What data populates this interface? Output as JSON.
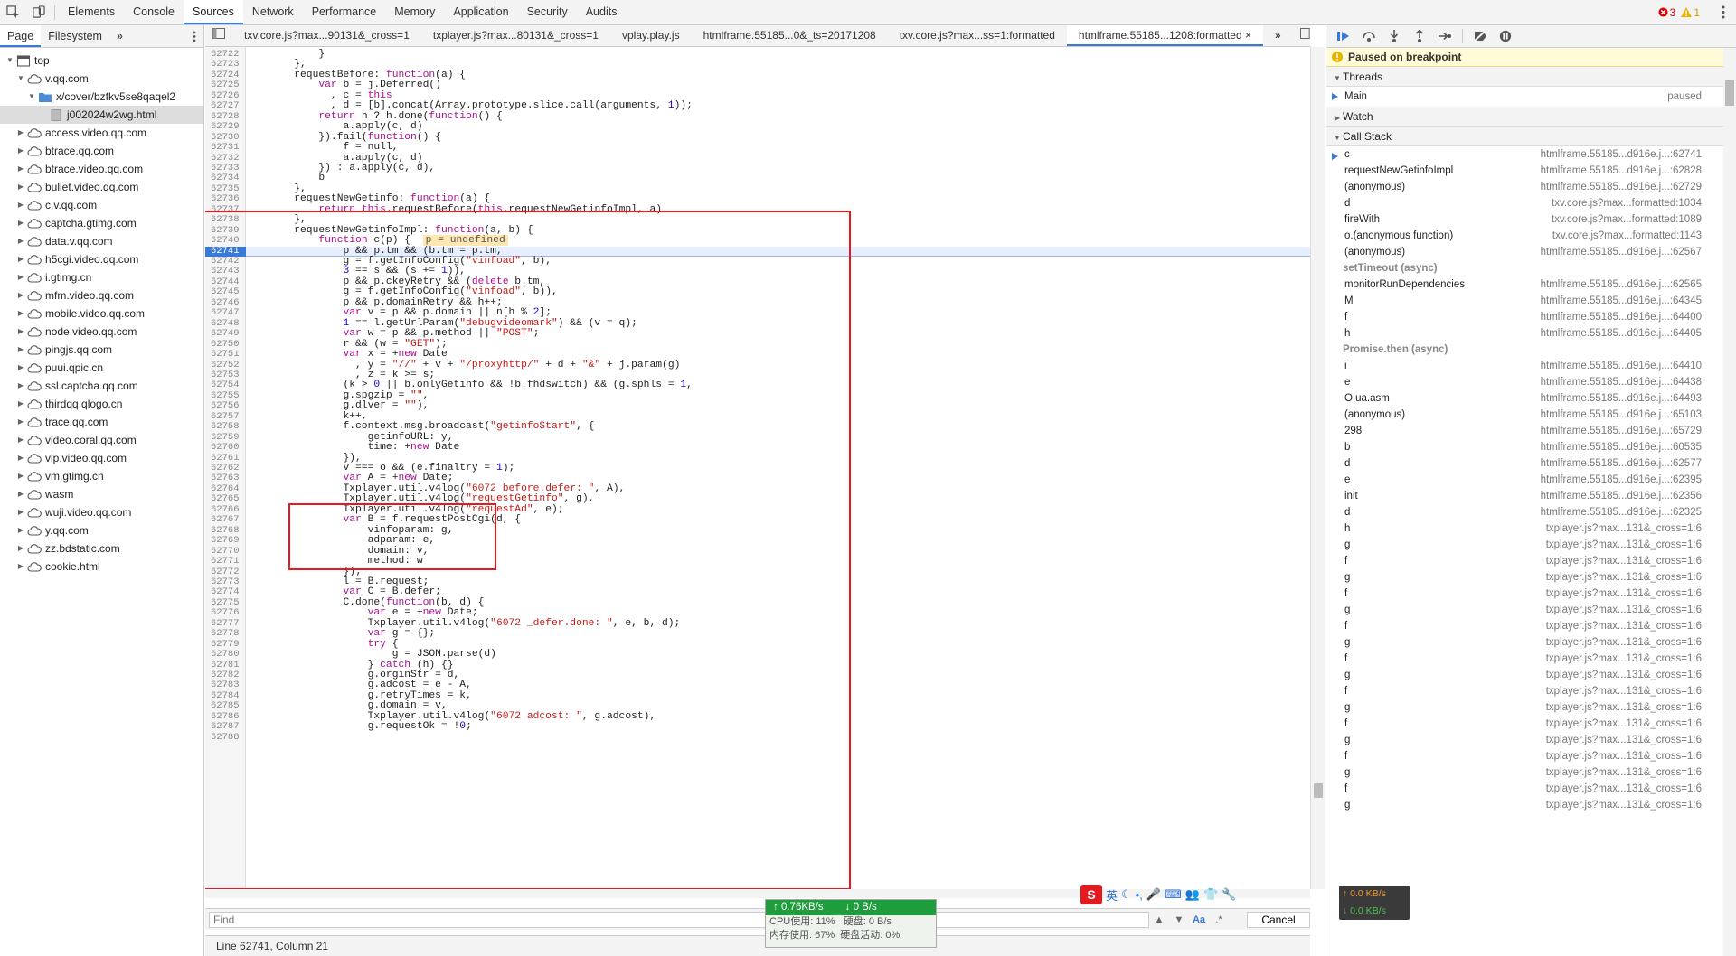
{
  "main_tabs": [
    "Elements",
    "Console",
    "Sources",
    "Network",
    "Performance",
    "Memory",
    "Application",
    "Security",
    "Audits"
  ],
  "active_main_tab": "Sources",
  "error_count": "3",
  "warning_count": "1",
  "sidebar": {
    "tabs": [
      "Page",
      "Filesystem"
    ],
    "tree": [
      {
        "label": "top",
        "depth": 0,
        "open": true,
        "kind": "frame"
      },
      {
        "label": "v.qq.com",
        "depth": 1,
        "open": true,
        "kind": "cloud"
      },
      {
        "label": "x/cover/bzfkv5se8qaqel2",
        "depth": 2,
        "open": true,
        "kind": "folder"
      },
      {
        "label": "j002024w2wg.html",
        "depth": 3,
        "open": false,
        "kind": "file",
        "selected": true
      },
      {
        "label": "access.video.qq.com",
        "depth": 1,
        "kind": "cloud"
      },
      {
        "label": "btrace.qq.com",
        "depth": 1,
        "kind": "cloud"
      },
      {
        "label": "btrace.video.qq.com",
        "depth": 1,
        "kind": "cloud"
      },
      {
        "label": "bullet.video.qq.com",
        "depth": 1,
        "kind": "cloud"
      },
      {
        "label": "c.v.qq.com",
        "depth": 1,
        "kind": "cloud"
      },
      {
        "label": "captcha.gtimg.com",
        "depth": 1,
        "kind": "cloud"
      },
      {
        "label": "data.v.qq.com",
        "depth": 1,
        "kind": "cloud"
      },
      {
        "label": "h5cgi.video.qq.com",
        "depth": 1,
        "kind": "cloud"
      },
      {
        "label": "i.gtimg.cn",
        "depth": 1,
        "kind": "cloud"
      },
      {
        "label": "mfm.video.qq.com",
        "depth": 1,
        "kind": "cloud"
      },
      {
        "label": "mobile.video.qq.com",
        "depth": 1,
        "kind": "cloud"
      },
      {
        "label": "node.video.qq.com",
        "depth": 1,
        "kind": "cloud"
      },
      {
        "label": "pingjs.qq.com",
        "depth": 1,
        "kind": "cloud"
      },
      {
        "label": "puui.qpic.cn",
        "depth": 1,
        "kind": "cloud"
      },
      {
        "label": "ssl.captcha.qq.com",
        "depth": 1,
        "kind": "cloud"
      },
      {
        "label": "thirdqq.qlogo.cn",
        "depth": 1,
        "kind": "cloud"
      },
      {
        "label": "trace.qq.com",
        "depth": 1,
        "kind": "cloud"
      },
      {
        "label": "video.coral.qq.com",
        "depth": 1,
        "kind": "cloud"
      },
      {
        "label": "vip.video.qq.com",
        "depth": 1,
        "kind": "cloud"
      },
      {
        "label": "vm.gtimg.cn",
        "depth": 1,
        "kind": "cloud"
      },
      {
        "label": "wasm",
        "depth": 1,
        "kind": "cloud"
      },
      {
        "label": "wuji.video.qq.com",
        "depth": 1,
        "kind": "cloud"
      },
      {
        "label": "y.qq.com",
        "depth": 1,
        "kind": "cloud"
      },
      {
        "label": "zz.bdstatic.com",
        "depth": 1,
        "kind": "cloud"
      },
      {
        "label": "cookie.html",
        "depth": 1,
        "kind": "cloud"
      }
    ]
  },
  "editor_tabs": [
    "txv.core.js?max...90131&_cross=1",
    "txplayer.js?max...80131&_cross=1",
    "vplay.play.js",
    "htmlframe.55185...0&_ts=20171208",
    "txv.core.js?max...ss=1:formatted",
    "htmlframe.55185...1208:formatted"
  ],
  "active_editor_tab": 5,
  "breakpoint_line": "62741",
  "code_lines": [
    {
      "n": "62722",
      "t": "            }"
    },
    {
      "n": "62723",
      "t": "        },"
    },
    {
      "n": "62724",
      "t": "        requestBefore: function(a) {"
    },
    {
      "n": "62725",
      "t": "            var b = j.Deferred()"
    },
    {
      "n": "62726",
      "t": "              , c = this"
    },
    {
      "n": "62727",
      "t": "              , d = [b].concat(Array.prototype.slice.call(arguments, 1));"
    },
    {
      "n": "62728",
      "t": "            return h ? h.done(function() {"
    },
    {
      "n": "62729",
      "t": "                a.apply(c, d)"
    },
    {
      "n": "62730",
      "t": "            }).fail(function() {"
    },
    {
      "n": "62731",
      "t": "                f = null,"
    },
    {
      "n": "62732",
      "t": "                a.apply(c, d)"
    },
    {
      "n": "62733",
      "t": "            }) : a.apply(c, d),"
    },
    {
      "n": "62734",
      "t": "            b"
    },
    {
      "n": "62735",
      "t": "        },"
    },
    {
      "n": "62736",
      "t": "        requestNewGetinfo: function(a) {"
    },
    {
      "n": "62737",
      "t": "            return this.requestBefore(this.requestNewGetinfoImpl, a)"
    },
    {
      "n": "62738",
      "t": "        },"
    },
    {
      "n": "62739",
      "t": "        requestNewGetinfoImpl: function(a, b) {"
    },
    {
      "n": "62740",
      "t": "            function c(p) {  ",
      "inline": "p = undefined"
    },
    {
      "n": "62741",
      "t": "                p && p.tm && (b.tm = p.tm,"
    },
    {
      "n": "62742",
      "t": "                g = f.getInfoConfig(\"vinfoad\", b),"
    },
    {
      "n": "62743",
      "t": "                3 == s && (s += 1)),"
    },
    {
      "n": "62744",
      "t": "                p && p.ckeyRetry && (delete b.tm,"
    },
    {
      "n": "62745",
      "t": "                g = f.getInfoConfig(\"vinfoad\", b)),"
    },
    {
      "n": "62746",
      "t": "                p && p.domainRetry && h++;"
    },
    {
      "n": "62747",
      "t": "                var v = p && p.domain || n[h % 2];"
    },
    {
      "n": "62748",
      "t": "                1 == l.getUrlParam(\"debugvideomark\") && (v = q);"
    },
    {
      "n": "62749",
      "t": "                var w = p && p.method || \"POST\";"
    },
    {
      "n": "62750",
      "t": "                r && (w = \"GET\");"
    },
    {
      "n": "62751",
      "t": "                var x = +new Date"
    },
    {
      "n": "62752",
      "t": "                  , y = \"//\" + v + \"/proxyhttp/\" + d + \"&\" + j.param(g)"
    },
    {
      "n": "62753",
      "t": "                  , z = k >= s;"
    },
    {
      "n": "62754",
      "t": "                (k > 0 || b.onlyGetinfo && !b.fhdswitch) && (g.sphls = 1,"
    },
    {
      "n": "62755",
      "t": "                g.spgzip = \"\","
    },
    {
      "n": "62756",
      "t": "                g.dlver = \"\"),"
    },
    {
      "n": "62757",
      "t": "                k++,"
    },
    {
      "n": "62758",
      "t": "                f.context.msg.broadcast(\"getinfoStart\", {"
    },
    {
      "n": "62759",
      "t": "                    getinfoURL: y,"
    },
    {
      "n": "62760",
      "t": "                    time: +new Date"
    },
    {
      "n": "62761",
      "t": "                }),"
    },
    {
      "n": "62762",
      "t": "                v === o && (e.finaltry = 1);"
    },
    {
      "n": "62763",
      "t": "                var A = +new Date;"
    },
    {
      "n": "62764",
      "t": "                Txplayer.util.v4log(\"6072 before.defer: \", A),"
    },
    {
      "n": "62765",
      "t": "                Txplayer.util.v4log(\"requestGetinfo\", g),"
    },
    {
      "n": "62766",
      "t": "                Txplayer.util.v4log(\"requestAd\", e);"
    },
    {
      "n": "62767",
      "t": "                var B = f.requestPostCgi(d, {"
    },
    {
      "n": "62768",
      "t": "                    vinfoparam: g,"
    },
    {
      "n": "62769",
      "t": "                    adparam: e,"
    },
    {
      "n": "62770",
      "t": "                    domain: v,"
    },
    {
      "n": "62771",
      "t": "                    method: w"
    },
    {
      "n": "62772",
      "t": "                });"
    },
    {
      "n": "62773",
      "t": "                l = B.request;"
    },
    {
      "n": "62774",
      "t": "                var C = B.defer;"
    },
    {
      "n": "62775",
      "t": "                C.done(function(b, d) {"
    },
    {
      "n": "62776",
      "t": "                    var e = +new Date;"
    },
    {
      "n": "62777",
      "t": "                    Txplayer.util.v4log(\"6072 _defer.done: \", e, b, d);"
    },
    {
      "n": "62778",
      "t": "                    var g = {};"
    },
    {
      "n": "62779",
      "t": "                    try {"
    },
    {
      "n": "62780",
      "t": "                        g = JSON.parse(d)"
    },
    {
      "n": "62781",
      "t": "                    } catch (h) {}"
    },
    {
      "n": "62782",
      "t": "                    g.orginStr = d,"
    },
    {
      "n": "62783",
      "t": "                    g.adcost = e - A,"
    },
    {
      "n": "62784",
      "t": "                    g.retryTimes = k,"
    },
    {
      "n": "62785",
      "t": "                    g.domain = v,"
    },
    {
      "n": "62786",
      "t": "                    Txplayer.util.v4log(\"6072 adcost: \", g.adcost),"
    },
    {
      "n": "62787",
      "t": "                    g.requestOk = !0;"
    },
    {
      "n": "62788",
      "t": ""
    }
  ],
  "find": {
    "placeholder": "Find",
    "cancel": "Cancel",
    "case_label": "Aa",
    "regex_label": ".*"
  },
  "status": "Line 62741, Column 21",
  "debugger": {
    "paused": "Paused on breakpoint",
    "threads_label": "Threads",
    "thread_name": "Main",
    "thread_state": "paused",
    "watch_label": "Watch",
    "callstack_label": "Call Stack",
    "frames": [
      {
        "name": "c",
        "loc": "htmlframe.55185...d916e.j...:62741",
        "current": true
      },
      {
        "name": "requestNewGetinfoImpl",
        "loc": "htmlframe.55185...d916e.j...:62828"
      },
      {
        "name": "(anonymous)",
        "loc": "htmlframe.55185...d916e.j...:62729"
      },
      {
        "name": "d",
        "loc": "txv.core.js?max...formatted:1034"
      },
      {
        "name": "fireWith",
        "loc": "txv.core.js?max...formatted:1089"
      },
      {
        "name": "o.(anonymous function)",
        "loc": "txv.core.js?max...formatted:1143"
      },
      {
        "name": "(anonymous)",
        "loc": "htmlframe.55185...d916e.j...:62567"
      },
      {
        "name": "setTimeout (async)",
        "loc": "",
        "async": true
      },
      {
        "name": "monitorRunDependencies",
        "loc": "htmlframe.55185...d916e.j...:62565"
      },
      {
        "name": "M",
        "loc": "htmlframe.55185...d916e.j...:64345"
      },
      {
        "name": "f",
        "loc": "htmlframe.55185...d916e.j...:64400"
      },
      {
        "name": "h",
        "loc": "htmlframe.55185...d916e.j...:64405"
      },
      {
        "name": "Promise.then (async)",
        "loc": "",
        "async": true
      },
      {
        "name": "i",
        "loc": "htmlframe.55185...d916e.j...:64410"
      },
      {
        "name": "e",
        "loc": "htmlframe.55185...d916e.j...:64438"
      },
      {
        "name": "O.ua.asm",
        "loc": "htmlframe.55185...d916e.j...:64493"
      },
      {
        "name": "(anonymous)",
        "loc": "htmlframe.55185...d916e.j...:65103"
      },
      {
        "name": "298",
        "loc": "htmlframe.55185...d916e.j...:65729"
      },
      {
        "name": "b",
        "loc": "htmlframe.55185...d916e.j...:60535"
      },
      {
        "name": "d",
        "loc": "htmlframe.55185...d916e.j...:62577"
      },
      {
        "name": "e",
        "loc": "htmlframe.55185...d916e.j...:62395"
      },
      {
        "name": "init",
        "loc": "htmlframe.55185...d916e.j...:62356"
      },
      {
        "name": "d",
        "loc": "htmlframe.55185...d916e.j...:62325"
      },
      {
        "name": "h",
        "loc": "txplayer.js?max...131&_cross=1:6"
      },
      {
        "name": "g",
        "loc": "txplayer.js?max...131&_cross=1:6"
      },
      {
        "name": "f",
        "loc": "txplayer.js?max...131&_cross=1:6"
      },
      {
        "name": "g",
        "loc": "txplayer.js?max...131&_cross=1:6"
      },
      {
        "name": "f",
        "loc": "txplayer.js?max...131&_cross=1:6"
      },
      {
        "name": "g",
        "loc": "txplayer.js?max...131&_cross=1:6"
      },
      {
        "name": "f",
        "loc": "txplayer.js?max...131&_cross=1:6"
      },
      {
        "name": "g",
        "loc": "txplayer.js?max...131&_cross=1:6"
      },
      {
        "name": "f",
        "loc": "txplayer.js?max...131&_cross=1:6"
      },
      {
        "name": "g",
        "loc": "txplayer.js?max...131&_cross=1:6"
      },
      {
        "name": "f",
        "loc": "txplayer.js?max...131&_cross=1:6"
      },
      {
        "name": "g",
        "loc": "txplayer.js?max...131&_cross=1:6"
      },
      {
        "name": "f",
        "loc": "txplayer.js?max...131&_cross=1:6"
      },
      {
        "name": "g",
        "loc": "txplayer.js?max...131&_cross=1:6"
      },
      {
        "name": "f",
        "loc": "txplayer.js?max...131&_cross=1:6"
      },
      {
        "name": "g",
        "loc": "txplayer.js?max...131&_cross=1:6"
      },
      {
        "name": "f",
        "loc": "txplayer.js?max...131&_cross=1:6"
      },
      {
        "name": "g",
        "loc": "txplayer.js?max...131&_cross=1:6"
      }
    ]
  },
  "net_monitor": {
    "upload": "0.76KB/s",
    "download": "0 B/s",
    "cpu": "CPU使用: 11%",
    "disk": "硬盘: 0 B/s",
    "mem": "内存使用: 67%",
    "disk_activity": "硬盘活动: 0%"
  },
  "speed_widget": {
    "up": "0.0 KB/s",
    "down": "0.0 KB/s"
  },
  "ime": {
    "lang": "英"
  },
  "colors": {
    "accent": "#3879d9",
    "highlight": "#e6191e",
    "paused_bg": "#fffbd8"
  }
}
